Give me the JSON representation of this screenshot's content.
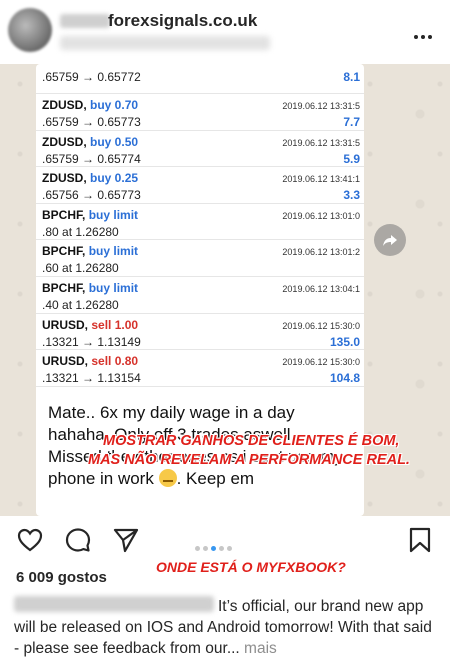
{
  "header": {
    "username": "forexsignals.co.uk",
    "more_icon": "more-dots-icon"
  },
  "trades": [
    {
      "pair": "",
      "direction": "",
      "date": "",
      "prices": ".65759 → 0.65772",
      "profit": "8.1"
    },
    {
      "pair": "ZDUSD,",
      "direction": "buy 0.70",
      "dir_type": "buy",
      "date": "2019.06.12 13:31:5",
      "prices": ".65759 → 0.65773",
      "profit": "7.7"
    },
    {
      "pair": "ZDUSD,",
      "direction": "buy 0.50",
      "dir_type": "buy",
      "date": "2019.06.12 13:31:5",
      "prices": ".65759 → 0.65774",
      "profit": "5.9"
    },
    {
      "pair": "ZDUSD,",
      "direction": "buy 0.25",
      "dir_type": "buy",
      "date": "2019.06.12 13:41:1",
      "prices": ".65756 → 0.65773",
      "profit": "3.3"
    },
    {
      "pair": "BPCHF,",
      "direction": "buy limit",
      "dir_type": "buy",
      "date": "2019.06.12 13:01:0",
      "prices": ".80 at 1.26280",
      "profit": ""
    },
    {
      "pair": "BPCHF,",
      "direction": "buy limit",
      "dir_type": "buy",
      "date": "2019.06.12 13:01:2",
      "prices": ".60 at 1.26280",
      "profit": ""
    },
    {
      "pair": "BPCHF,",
      "direction": "buy limit",
      "dir_type": "buy",
      "date": "2019.06.12 13:04:1",
      "prices": ".40 at 1.26280",
      "profit": ""
    },
    {
      "pair": "URUSD,",
      "direction": "sell 1.00",
      "dir_type": "sell",
      "date": "2019.06.12 15:30:0",
      "prices": ".13321 → 1.13149",
      "profit": "135.0"
    },
    {
      "pair": "URUSD,",
      "direction": "sell 0.80",
      "dir_type": "sell",
      "date": "2019.06.12 15:30:0",
      "prices": ".13321 → 1.13154",
      "profit": "104.8"
    }
  ],
  "message": {
    "text": "Mate.. 6x my daily wage in a day hahaha, Only off 3 trades aswell. Missed the other ones as i cant use my phone in work",
    "tail": ". Keep em"
  },
  "overlay": {
    "line1": "MOSTRAR GANHOS DE CLIENTES É BOM,",
    "line2": "MAS NÃO REVELAM A PERFORMANCE REAL.",
    "line3": "ONDE ESTÁ O MYFXBOOK?"
  },
  "actions": {
    "like_icon": "heart-icon",
    "comment_icon": "comment-icon",
    "share_icon": "send-icon",
    "save_icon": "bookmark-icon",
    "carousel_total": 5,
    "carousel_active": 3
  },
  "likes": "6 009 gostos",
  "caption": {
    "text": "It’s official, our brand new app will be released on IOS and Android tomorrow! With that said - please see feedback from our...",
    "more": " mais"
  },
  "colors": {
    "buy": "#2b6fd6",
    "sell": "#d6322b",
    "overlay": "#e0201b",
    "accent": "#3897f0"
  }
}
